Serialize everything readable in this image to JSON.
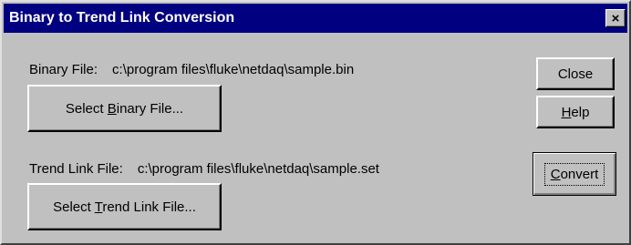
{
  "window": {
    "title": "Binary to Trend Link Conversion",
    "close_glyph": "×"
  },
  "binary": {
    "label": "Binary File:",
    "path": "c:\\program files\\fluke\\netdaq\\sample.bin",
    "button_pre": "Select ",
    "button_key": "B",
    "button_post": "inary File..."
  },
  "trend": {
    "label": "Trend Link File:",
    "path": "c:\\program files\\fluke\\netdaq\\sample.set",
    "button_pre": "Select ",
    "button_key": "T",
    "button_post": "rend Link File..."
  },
  "buttons": {
    "close": "Close",
    "help_key": "H",
    "help_rest": "elp",
    "convert_key": "C",
    "convert_rest": "onvert"
  },
  "colors": {
    "titlebar": "#000080",
    "face": "#c0c0c0"
  }
}
